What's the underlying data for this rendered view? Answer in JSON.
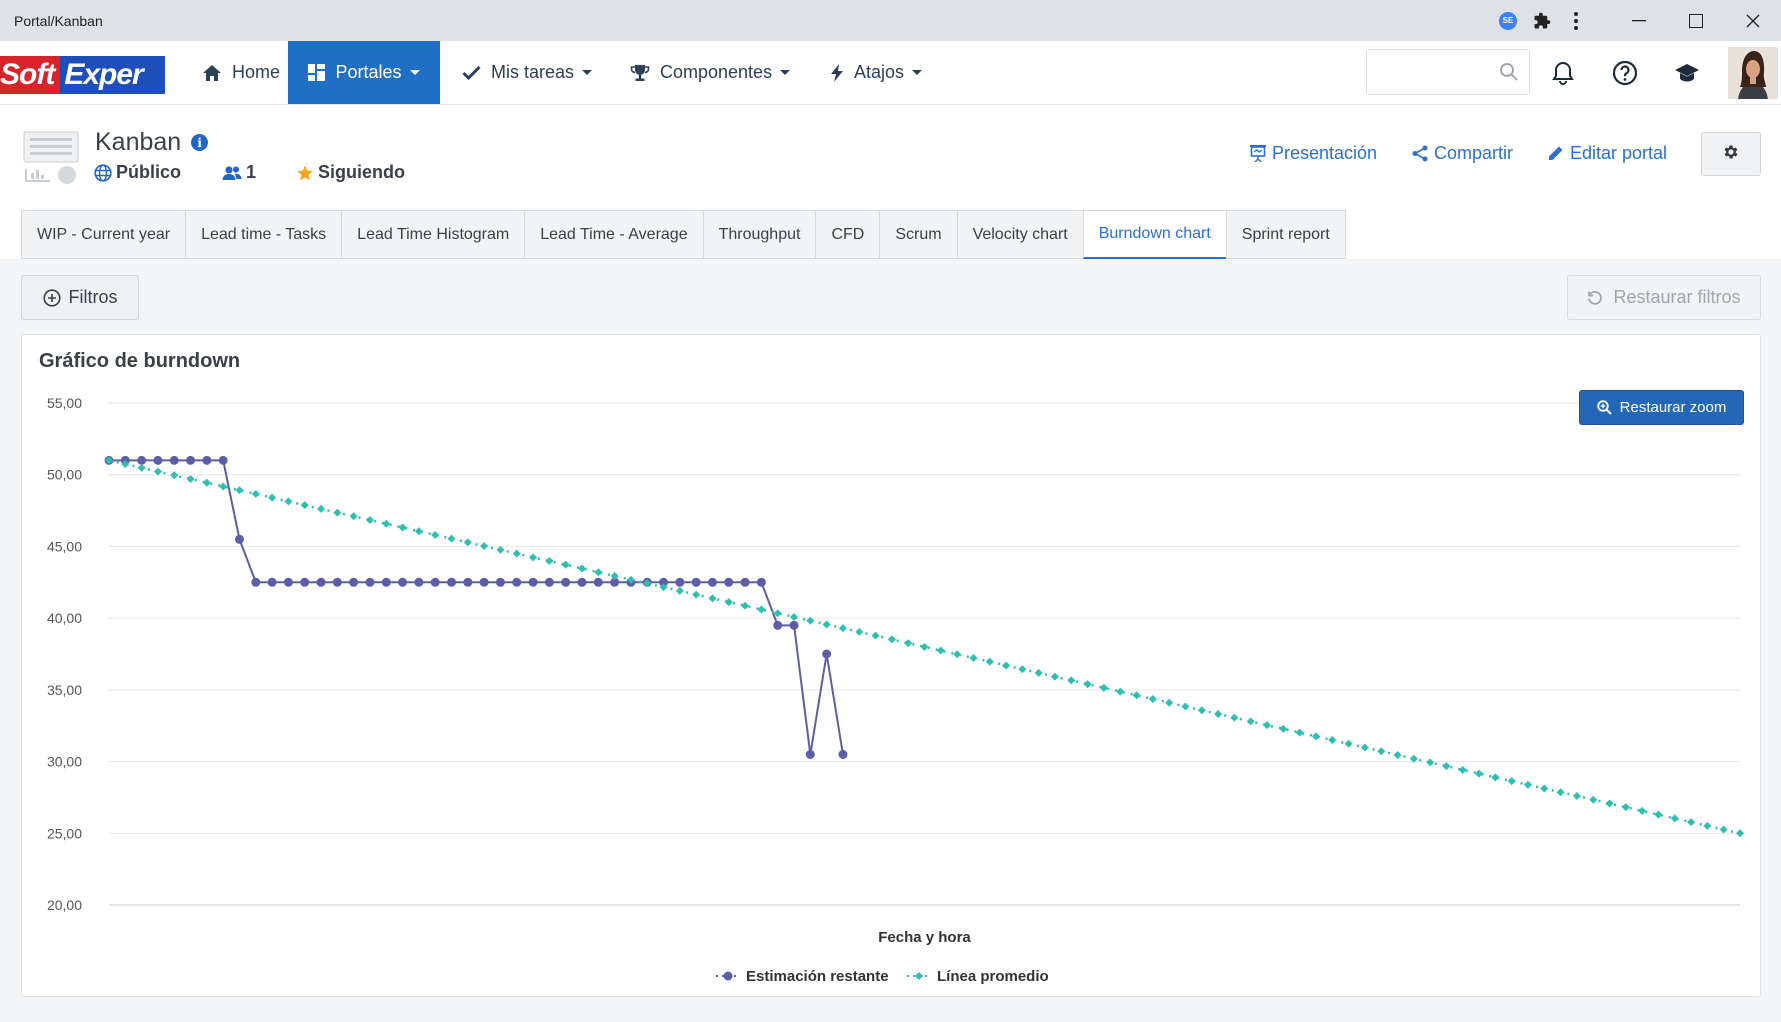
{
  "window": {
    "title": "Portal/Kanban",
    "extension_badge": "SE"
  },
  "navbar": {
    "logo_part1": "Soft",
    "logo_part2": "Exper",
    "items": [
      {
        "label": "Home",
        "icon": "home-icon",
        "dropdown": false
      },
      {
        "label": "Portales",
        "icon": "grid-icon",
        "dropdown": true,
        "active": true
      },
      {
        "label": "Mis tareas",
        "icon": "check-icon",
        "dropdown": true
      },
      {
        "label": "Componentes",
        "icon": "trophy-icon",
        "dropdown": true
      },
      {
        "label": "Atajos",
        "icon": "bolt-icon",
        "dropdown": true
      }
    ],
    "search": {
      "value": "",
      "placeholder": ""
    }
  },
  "header": {
    "title": "Kanban",
    "visibility": "Público",
    "members": "1",
    "follow": "Siguiendo",
    "links": {
      "presentation": "Presentación",
      "share": "Compartir",
      "edit": "Editar portal"
    }
  },
  "tabs": [
    {
      "label": "WIP - Current year"
    },
    {
      "label": "Lead time - Tasks"
    },
    {
      "label": "Lead Time Histogram"
    },
    {
      "label": "Lead Time - Average"
    },
    {
      "label": "Throughput"
    },
    {
      "label": "CFD"
    },
    {
      "label": "Scrum"
    },
    {
      "label": "Velocity chart"
    },
    {
      "label": "Burndown chart",
      "active": true
    },
    {
      "label": "Sprint report"
    }
  ],
  "filters": {
    "filter_label": "Filtros",
    "restore_label": "Restaurar filtros"
  },
  "panel": {
    "title": "Gráfico de burndown",
    "zoom_label": "Restaurar zoom"
  },
  "colors": {
    "brand_blue": "#1f6fc5",
    "link_blue": "#2a6fd1",
    "series_remaining": "#5b5ea6",
    "series_average": "#2ebfb1"
  },
  "chart_data": {
    "type": "line",
    "title": "Gráfico de burndown",
    "xlabel": "Fecha y hora",
    "ylabel": "",
    "ylim": [
      20,
      55
    ],
    "yticks": [
      "20,00",
      "25,00",
      "30,00",
      "35,00",
      "40,00",
      "45,00",
      "50,00",
      "55,00"
    ],
    "grid": true,
    "legend_position": "bottom-center",
    "x": [
      1,
      2,
      3,
      4,
      5,
      6,
      7,
      8,
      9,
      10,
      11,
      12,
      13,
      14,
      15,
      16,
      17,
      18,
      19,
      20,
      21,
      22,
      23,
      24,
      25,
      26,
      27,
      28,
      29,
      30,
      31,
      32,
      33,
      34,
      35,
      36,
      37,
      38,
      39,
      40,
      41,
      42,
      43,
      44,
      45,
      46,
      47,
      48,
      49,
      50,
      51,
      52,
      53,
      54,
      55,
      56,
      57,
      58,
      59,
      60,
      61,
      62,
      63,
      64,
      65,
      66,
      67,
      68,
      69,
      70,
      71,
      72,
      73,
      74,
      75,
      76,
      77,
      78,
      79,
      80,
      81,
      82,
      83,
      84,
      85,
      86,
      87,
      88,
      89,
      90,
      91,
      92,
      93,
      94,
      95,
      96,
      97,
      98,
      99,
      100,
      101
    ],
    "series": [
      {
        "name": "Estimación restante",
        "values": [
          51,
          51,
          51,
          51,
          51,
          51,
          51,
          51,
          45.5,
          42.5,
          42.5,
          42.5,
          42.5,
          42.5,
          42.5,
          42.5,
          42.5,
          42.5,
          42.5,
          42.5,
          42.5,
          42.5,
          42.5,
          42.5,
          42.5,
          42.5,
          42.5,
          42.5,
          42.5,
          42.5,
          42.5,
          42.5,
          42.5,
          42.5,
          42.5,
          42.5,
          42.5,
          42.5,
          42.5,
          42.5,
          42.5,
          39.5,
          39.5,
          30.5,
          37.5,
          30.5
        ]
      },
      {
        "name": "Línea promedio",
        "values": [
          51,
          50.74,
          50.48,
          50.22,
          49.96,
          49.7,
          49.44,
          49.18,
          48.92,
          48.66,
          48.4,
          48.14,
          47.88,
          47.62,
          47.36,
          47.1,
          46.84,
          46.58,
          46.32,
          46.06,
          45.8,
          45.54,
          45.28,
          45.02,
          44.76,
          44.5,
          44.24,
          43.98,
          43.72,
          43.46,
          43.2,
          42.94,
          42.68,
          42.42,
          42.16,
          41.9,
          41.64,
          41.38,
          41.12,
          40.86,
          40.6,
          40.34,
          40.08,
          39.82,
          39.56,
          39.3,
          39.04,
          38.78,
          38.52,
          38.26,
          38,
          37.74,
          37.48,
          37.22,
          36.96,
          36.7,
          36.44,
          36.18,
          35.92,
          35.66,
          35.4,
          35.14,
          34.88,
          34.62,
          34.36,
          34.1,
          33.84,
          33.58,
          33.32,
          33.06,
          32.8,
          32.54,
          32.28,
          32.02,
          31.76,
          31.5,
          31.24,
          30.98,
          30.72,
          30.46,
          30.2,
          29.94,
          29.68,
          29.42,
          29.16,
          28.9,
          28.64,
          28.38,
          28.12,
          27.86,
          27.6,
          27.34,
          27.08,
          26.82,
          26.56,
          26.3,
          26.04,
          25.78,
          25.52,
          25.26,
          25
        ]
      }
    ]
  }
}
